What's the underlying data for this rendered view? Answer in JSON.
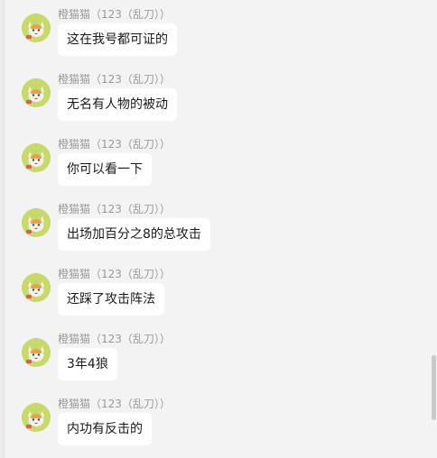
{
  "messages": [
    {
      "sender": "橙猫猫（123（乱刀））",
      "text": "这在我号都可证的"
    },
    {
      "sender": "橙猫猫（123（乱刀））",
      "text": "无名有人物的被动"
    },
    {
      "sender": "橙猫猫（123（乱刀））",
      "text": "你可以看一下"
    },
    {
      "sender": "橙猫猫（123（乱刀））",
      "text": "出场加百分之8的总攻击"
    },
    {
      "sender": "橙猫猫（123（乱刀））",
      "text": "还踩了攻击阵法"
    },
    {
      "sender": "橙猫猫（123（乱刀））",
      "text": "3年4狼"
    },
    {
      "sender": "橙猫猫（123（乱刀））",
      "text": "内功有反击的"
    }
  ],
  "avatar_icon": "cat-avatar-icon",
  "colors": {
    "background": "#f3f3f3",
    "bubble": "#ffffff",
    "nickname": "#9a9a9a",
    "avatar_bg": "#c8d96b"
  }
}
